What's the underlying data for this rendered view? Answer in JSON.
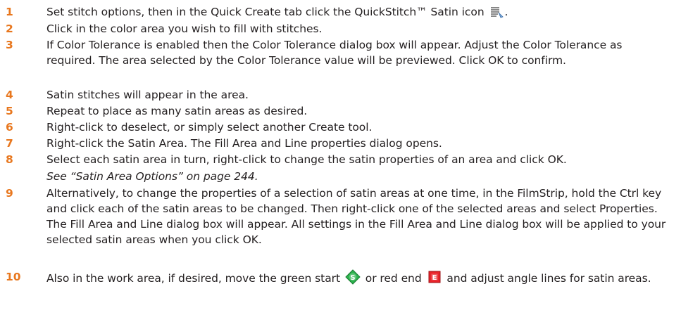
{
  "steps": [
    {
      "num": "1",
      "text_a": "Set stitch options, then in the Quick Create tab click the QuickStitch™ Satin icon",
      "text_b": "."
    },
    {
      "num": "2",
      "text": "Click in the color area you wish to fill with stitches."
    },
    {
      "num": "3",
      "text": "If Color Tolerance is enabled then the Color Tolerance dialog box will appear. Adjust the Color Tolerance as required. The area selected by the Color Tolerance value will be previewed. Click OK to confirm."
    },
    {
      "num": "4",
      "text": "Satin stitches will appear in the area."
    },
    {
      "num": "5",
      "text": "Repeat to place as many satin areas as desired."
    },
    {
      "num": "6",
      "text": "Right-click to deselect, or simply select another Create tool."
    },
    {
      "num": "7",
      "text": "Right-click the Satin Area. The Fill Area and Line properties dialog opens."
    },
    {
      "num": "8",
      "text": "Select each satin area in turn, right-click to change the satin properties of an area and click OK.",
      "ref": "See “Satin Area Options” on page 244."
    },
    {
      "num": "9",
      "text": "Alternatively, to change the properties of a selection of satin areas at one time, in the FilmStrip, hold the Ctrl key and click each of the satin areas to be changed. Then right-click one of the selected areas and select Properties. The Fill Area and Line dialog box will appear. All settings in the Fill Area and Line dialog box will be applied to your selected satin areas when you click OK."
    },
    {
      "num": "10",
      "text_a": "Also in the work area, if desired, move the green start",
      "text_b": "or red end",
      "text_c": "and adjust angle lines for satin areas."
    }
  ],
  "icons": {
    "satin": "quickstitch-satin-icon",
    "start": "green-start-marker-icon",
    "end": "red-end-marker-icon",
    "start_letter": "S",
    "end_letter": "E"
  },
  "colors": {
    "step_number": "#e8771e",
    "body_text": "#231f20",
    "start_green": "#2bb24c",
    "end_red": "#e8232a"
  }
}
